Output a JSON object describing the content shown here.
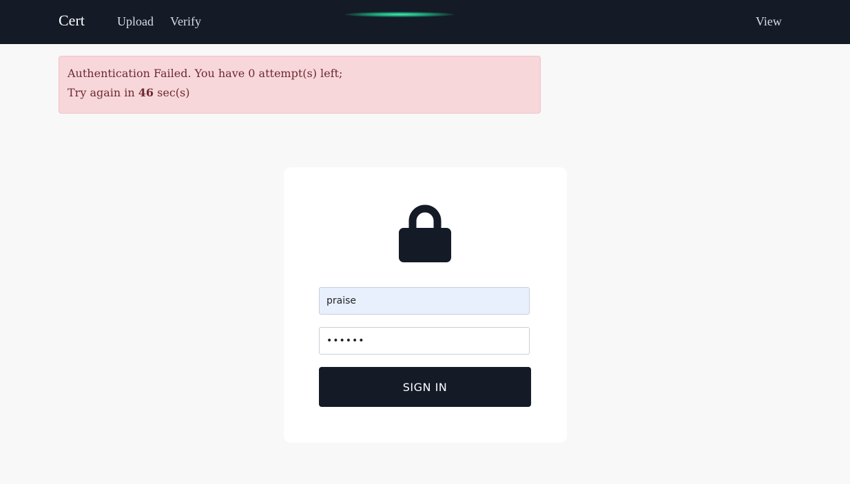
{
  "navbar": {
    "brand": "Cert",
    "links": [
      "Upload",
      "Verify"
    ],
    "right_link": "View"
  },
  "alert": {
    "line1": "Authentication Failed. You have 0 attempt(s) left;",
    "line2_prefix": "Try again in ",
    "seconds": "46",
    "line2_suffix": " sec(s)"
  },
  "login": {
    "lock_icon": "lock-icon",
    "username_value": "praise",
    "password_value": "••••••",
    "submit_label": "SIGN IN"
  },
  "colors": {
    "navbar_bg": "#141a26",
    "alert_bg": "#f8d7da",
    "alert_text": "#6b2a31",
    "button_bg": "#141a26",
    "autofill_bg": "#e8f0fe"
  }
}
